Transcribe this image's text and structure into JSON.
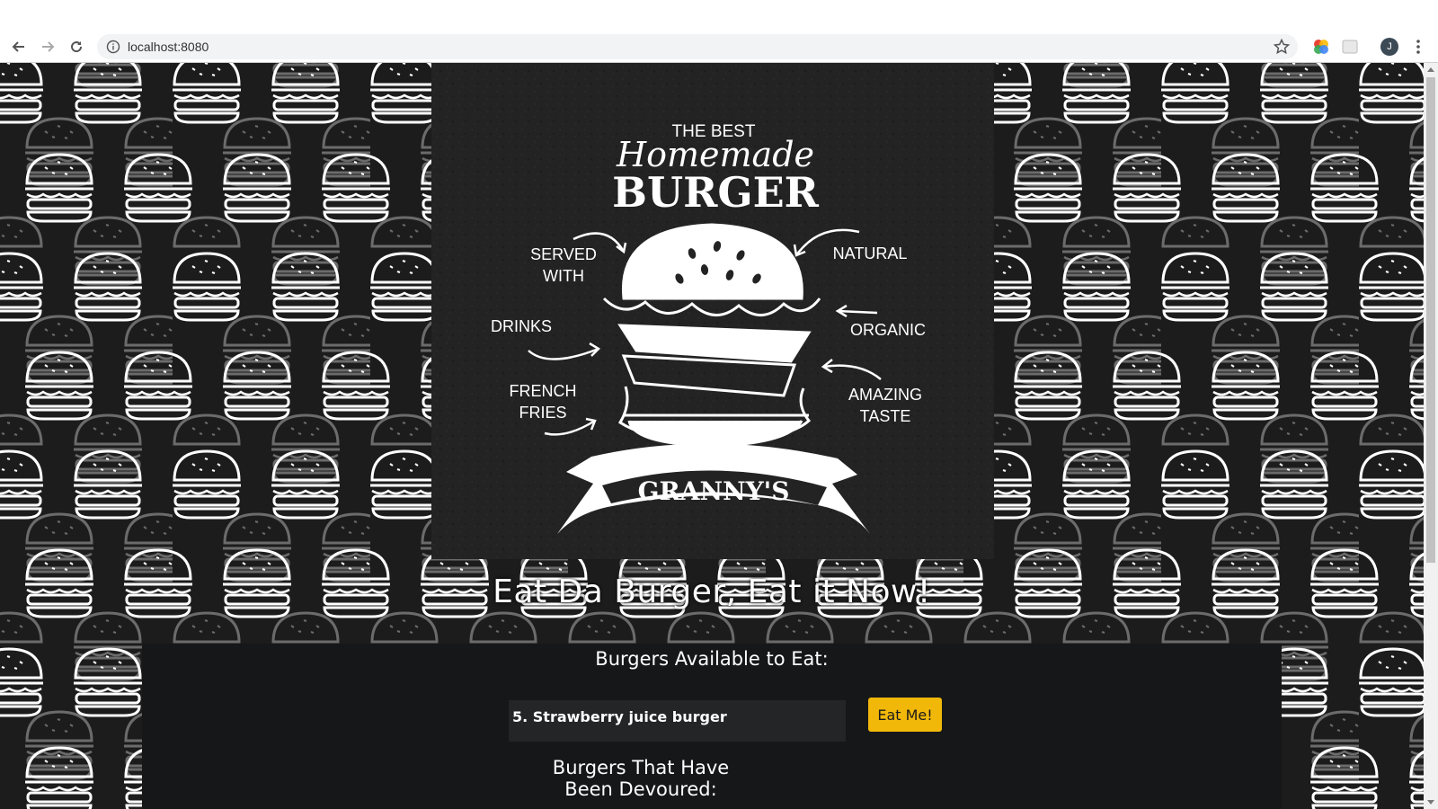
{
  "browser": {
    "url": "localhost:8080",
    "avatar_initial": "J"
  },
  "poster": {
    "kicker": "THE BEST",
    "script_title": "Homemade",
    "title": "BURGER",
    "left_notes": [
      "SERVED",
      "WITH",
      "DRINKS",
      "FRENCH",
      "FRIES"
    ],
    "right_notes": [
      "NATURAL",
      "ORGANIC",
      "AMAZING",
      "TASTE"
    ],
    "banner": "GRANNY'S"
  },
  "slogan": "Eat Da Burger, Eat it Now!",
  "available": {
    "title": "Burgers Available to Eat:",
    "items": [
      {
        "label": "5. Strawberry juice burger",
        "button": "Eat Me!"
      }
    ]
  },
  "devoured": {
    "title": "Burgers That Have Been Devoured:"
  },
  "colors": {
    "button": "#f2b809",
    "panel": "#151719",
    "background": "#1c1c1c"
  }
}
